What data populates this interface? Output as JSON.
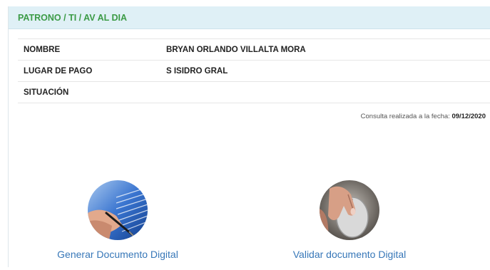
{
  "panel": {
    "title": "PATRONO / TI / AV AL DIA"
  },
  "info": {
    "rows": [
      {
        "label": "NOMBRE",
        "value": "BRYAN ORLANDO VILLALTA MORA"
      },
      {
        "label": "LUGAR DE PAGO",
        "value": "S ISIDRO GRAL"
      },
      {
        "label": "SITUACIÓN",
        "value": ""
      }
    ]
  },
  "consult": {
    "prefix": "Consulta realizada a la fecha:",
    "date": "09/12/2020"
  },
  "actions": {
    "generate_label": "Generar Documento Digital",
    "generate_icon": "document-signing-icon",
    "validate_label": "Validar documento Digital",
    "validate_icon": "mouse-hand-icon"
  },
  "colors": {
    "header_bg": "#dff0f6",
    "header_text": "#3c9b46",
    "link": "#3777b8"
  }
}
